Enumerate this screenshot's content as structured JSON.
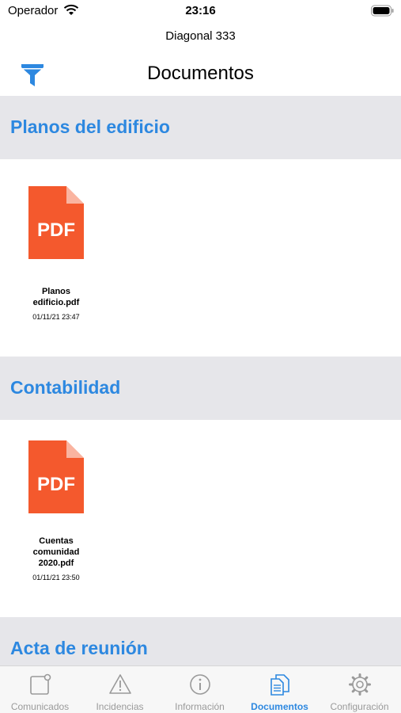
{
  "status_bar": {
    "carrier": "Operador",
    "time": "23:16"
  },
  "header": {
    "subtitle": "Diagonal 333",
    "title": "Documentos"
  },
  "sections": [
    {
      "title": "Planos del edificio",
      "documents": [
        {
          "icon": "pdf-file-icon",
          "icon_label": "PDF",
          "name": "Planos edificio.pdf",
          "date": "01/11/21 23:47"
        }
      ]
    },
    {
      "title": "Contabilidad",
      "documents": [
        {
          "icon": "pdf-file-icon",
          "icon_label": "PDF",
          "name": "Cuentas comunidad 2020.pdf",
          "date": "01/11/21 23:50"
        }
      ]
    },
    {
      "title": "Acta de reunión",
      "documents": []
    }
  ],
  "tabs": [
    {
      "label": "Comunicados",
      "icon": "message-square-icon",
      "active": false
    },
    {
      "label": "Incidencias",
      "icon": "warning-triangle-icon",
      "active": false
    },
    {
      "label": "Información",
      "icon": "info-circle-icon",
      "active": false
    },
    {
      "label": "Documentos",
      "icon": "documents-icon",
      "active": true
    },
    {
      "label": "Configuración",
      "icon": "gear-icon",
      "active": false
    }
  ],
  "colors": {
    "accent": "#2d88e0",
    "section_bg": "#e6e6ea",
    "pdf": "#f4592d",
    "tab_inactive": "#9a9a9a"
  }
}
